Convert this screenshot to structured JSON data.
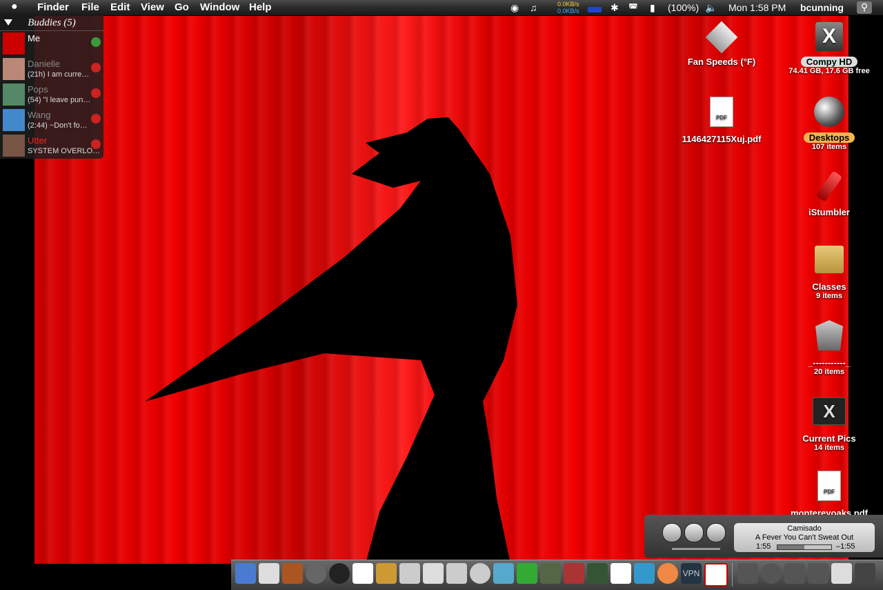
{
  "menubar": {
    "app": "Finder",
    "items": [
      "File",
      "Edit",
      "View",
      "Go",
      "Window",
      "Help"
    ],
    "net_up": "0.0KB/s",
    "net_down": "0.0KB/s",
    "battery": "(100%)",
    "clock": "Mon 1:58 PM",
    "user": "bcunning"
  },
  "buddies": {
    "title": "Buddies (5)",
    "list": [
      {
        "name": "Me",
        "status": "",
        "name_color": "#ffffff",
        "badge": "#3a9a3a"
      },
      {
        "name": "Danielle",
        "status": "(21h) I am curre…",
        "name_color": "#8a8a8a",
        "badge": "#cc2222"
      },
      {
        "name": "Pops",
        "status": "(54) \"I leave pun…",
        "name_color": "#8a8a8a",
        "badge": "#cc2222"
      },
      {
        "name": "Wang",
        "status": "(2:44) ~Don't fo…",
        "name_color": "#8a8a8a",
        "badge": "#cc2222"
      },
      {
        "name": "Utter",
        "status": "SYSTEM OVERLO…",
        "name_color": "#ff2020",
        "badge": "#cc2222"
      }
    ]
  },
  "desktop": {
    "fan": {
      "label": "Fan Speeds (°F)"
    },
    "hd": {
      "label": "Compy HD",
      "sub": "74.41 GB, 17.6 GB free"
    },
    "pdf1": {
      "label": "1146427115Xuj.pdf"
    },
    "desktops": {
      "label": "Desktops",
      "sub": "107 items"
    },
    "istumbler": {
      "label": "iStumbler"
    },
    "classes": {
      "label": "Classes",
      "sub": "9 items"
    },
    "folder5": {
      "label": "_-----------_",
      "sub": "20 items"
    },
    "currentpics": {
      "label": "Current Pics",
      "sub": "14 items"
    },
    "pdf2": {
      "label": "montereyoaks.pdf"
    }
  },
  "itunes": {
    "artist": "Camisado",
    "song": "A Fever You Can't Sweat Out",
    "elapsed": "1:55",
    "remaining": "–1:55",
    "progress": 0.5
  },
  "dock": {
    "vpn": "VPN"
  },
  "colors": {
    "wallpaper": "#e80000",
    "menubar": "#2a2a2a"
  }
}
